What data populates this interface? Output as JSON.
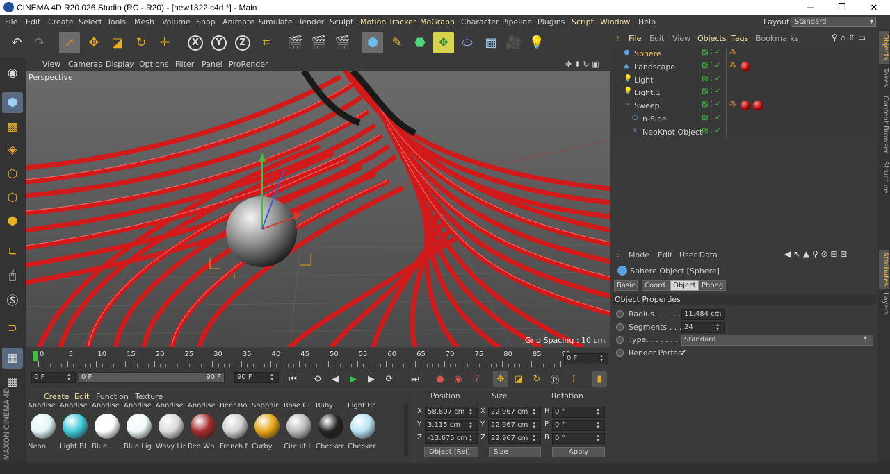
{
  "window": {
    "title": "CINEMA 4D R20.026 Studio (RC - R20) - [new1322.c4d *] - Main",
    "minimize": "─",
    "maximize": "❐",
    "close": "✕"
  },
  "menu": [
    "File",
    "Edit",
    "Create",
    "Select",
    "Tools",
    "Mesh",
    "Volume",
    "Snap",
    "Animate",
    "Simulate",
    "Render",
    "Sculpt",
    "Motion Tracker",
    "MoGraph",
    "Character",
    "Pipeline",
    "Plugins",
    "Script",
    "Window",
    "Help"
  ],
  "layout": {
    "label": "Layout:",
    "value": "Standard"
  },
  "viewport": {
    "menu": [
      "View",
      "Cameras",
      "Display",
      "Options",
      "Filter",
      "Panel",
      "ProRender"
    ],
    "camera_label": "Perspective",
    "grid_spacing": "Grid Spacing : 10 cm"
  },
  "timeline": {
    "ticks": [
      "0",
      "5",
      "10",
      "15",
      "20",
      "25",
      "30",
      "35",
      "40",
      "45",
      "50",
      "55",
      "60",
      "65",
      "70",
      "75",
      "80",
      "85",
      "90"
    ],
    "current_frame": "0 F",
    "start": "0 F",
    "range_start": "0 F",
    "range_end": "90 F",
    "end": "90 F"
  },
  "materials": {
    "menu": [
      "Create",
      "Edit",
      "Function",
      "Texture"
    ],
    "top_labels": [
      "Anodise",
      "Anodise",
      "Anodise",
      "Anodise",
      "Anodise",
      "Anodise",
      "Beer Bo",
      "Sapphir",
      "Rose Gl",
      "Ruby",
      "Light Br"
    ],
    "items": [
      {
        "label": "Neon",
        "color": "#dff6f6"
      },
      {
        "label": "Light Bl",
        "color": "#3ec9d8"
      },
      {
        "label": "Blue",
        "color": "#ffffff"
      },
      {
        "label": "Blue Lig",
        "color": "#f0fafa"
      },
      {
        "label": "Wavy Lir",
        "color": "#d9d9d9"
      },
      {
        "label": "Red Wh",
        "color": "#a52a2a"
      },
      {
        "label": "French f",
        "color": "#cfcfcf"
      },
      {
        "label": "Curby",
        "color": "#e4a316"
      },
      {
        "label": "Circuit L",
        "color": "#b9b9b9"
      },
      {
        "label": "Checker",
        "color": "#222222"
      },
      {
        "label": "Checker",
        "color": "#b6e2f2"
      }
    ]
  },
  "coords": {
    "headers": [
      "Position",
      "Size",
      "Rotation"
    ],
    "rows": [
      {
        "axis": "X",
        "pos": "58.807 cm",
        "size_axis": "X",
        "size": "22.967 cm",
        "rot_axis": "H",
        "rot": "0 °"
      },
      {
        "axis": "Y",
        "pos": "3.115 cm",
        "size_axis": "Y",
        "size": "22.967 cm",
        "rot_axis": "P",
        "rot": "0 °"
      },
      {
        "axis": "Z",
        "pos": "-13.675 cm",
        "size_axis": "Z",
        "size": "22.967 cm",
        "rot_axis": "B",
        "rot": "0 °"
      }
    ],
    "mode": "Object (Rel)",
    "size_mode": "Size",
    "apply": "Apply"
  },
  "objects": {
    "menu": [
      "File",
      "Edit",
      "View",
      "Objects",
      "Tags",
      "Bookmarks"
    ],
    "items": [
      {
        "name": "Sphere",
        "active": true,
        "indent": 0
      },
      {
        "name": "Landscape",
        "active": false,
        "indent": 0
      },
      {
        "name": "Light",
        "active": false,
        "indent": 0
      },
      {
        "name": "Light.1",
        "active": false,
        "indent": 0
      },
      {
        "name": "Sweep",
        "active": false,
        "indent": 0
      },
      {
        "name": "n-Side",
        "active": false,
        "indent": 1
      },
      {
        "name": "NeoKnot Object",
        "active": false,
        "indent": 1
      }
    ]
  },
  "attributes": {
    "menu": [
      "Mode",
      "Edit",
      "User Data"
    ],
    "object_title": "Sphere Object [Sphere]",
    "tabs": [
      "Basic",
      "Coord.",
      "Object",
      "Phong"
    ],
    "active_tab": "Object",
    "section": "Object Properties",
    "props": [
      {
        "label": "Radius. . . . . . .",
        "value": "11.484 cm"
      },
      {
        "label": "Segments . . . .",
        "value": "24"
      },
      {
        "label": "Type. . . . . . . . .",
        "value": "Standard"
      },
      {
        "label": "Render Perfect",
        "value": "✓"
      }
    ]
  },
  "right_tabs": [
    "Objects",
    "Takes",
    "Content Browser",
    "Structure",
    "Attributes",
    "Layers"
  ],
  "brand": "MAXON CINEMA 4D"
}
